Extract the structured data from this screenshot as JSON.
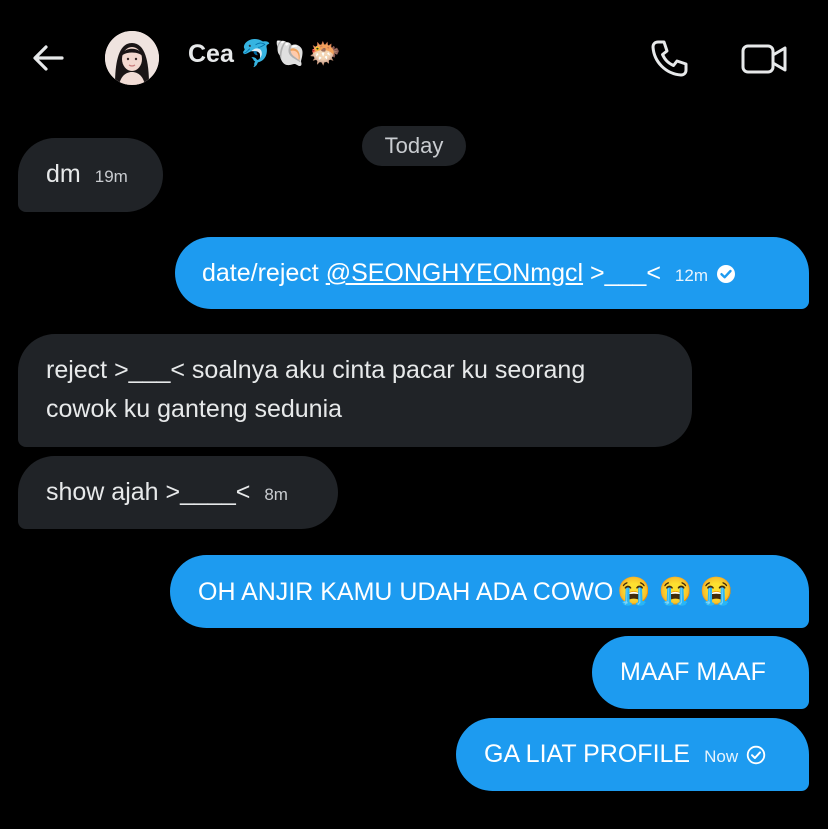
{
  "header": {
    "contact_name": "Cea",
    "name_emojis": "🐬🐚🐡"
  },
  "date_separator": "Today",
  "messages": [
    {
      "direction": "in",
      "text": "dm",
      "time": "19m"
    },
    {
      "direction": "out",
      "text_prefix": "date/reject ",
      "mention": "@SEONGHYEONmgcl",
      "text_suffix": " >___<",
      "time": "12m",
      "status": "read"
    },
    {
      "direction": "in",
      "line1": "reject >___< soalnya aku cinta pacar ku seorang",
      "line2": "cowok ku ganteng sedunia"
    },
    {
      "direction": "in",
      "text": "show ajah >____<",
      "time": "8m"
    },
    {
      "direction": "out",
      "text": "OH ANJIR KAMU UDAH ADA COWO",
      "emojis": "😭 😭 😭"
    },
    {
      "direction": "out",
      "text": "MAAF MAAF"
    },
    {
      "direction": "out",
      "text": "GA LIAT PROFILE",
      "time": "Now",
      "status": "sent"
    }
  ],
  "colors": {
    "background": "#000000",
    "incoming_bubble": "#202327",
    "outgoing_bubble": "#1d9bf0"
  }
}
